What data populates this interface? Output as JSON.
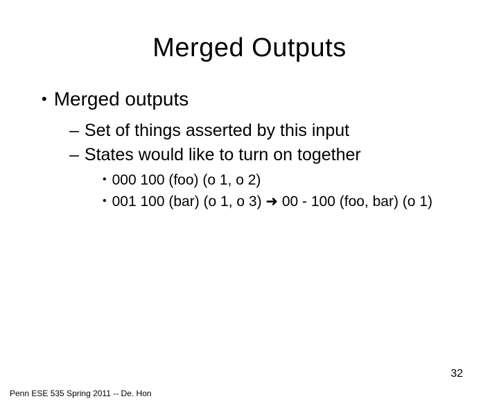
{
  "title": "Merged Outputs",
  "bullets": {
    "l1_0": "Merged outputs",
    "l2_0": "Set of things asserted by this input",
    "l2_1": "States would like to turn on together",
    "l3_0": "000 100 (foo) (o 1, o 2)",
    "l3_1_a": "001 100 (bar) (o 1, o 3) ",
    "l3_1_arrow": "➜",
    "l3_1_b": " 00 - 100 (foo, bar) (o 1)"
  },
  "footer": "Penn ESE 535 Spring 2011 -- De. Hon",
  "page_number": "32"
}
